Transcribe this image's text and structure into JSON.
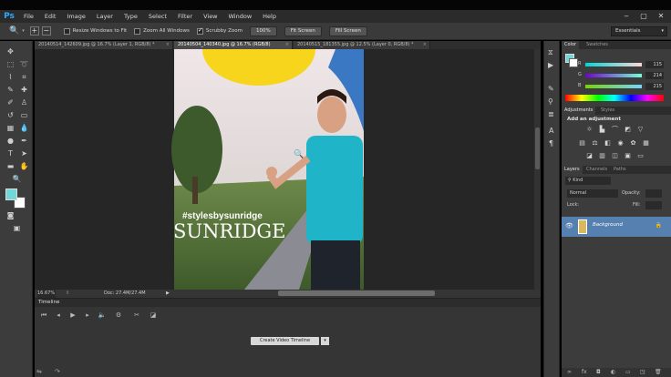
{
  "app": {
    "logo": "Ps"
  },
  "menu": [
    "File",
    "Edit",
    "Image",
    "Layer",
    "Type",
    "Select",
    "Filter",
    "View",
    "Window",
    "Help"
  ],
  "window_controls": {
    "minimize": "‒",
    "maximize": "▢",
    "close": "✕"
  },
  "options": {
    "resize_windows_label": "Resize Windows to Fit",
    "zoom_all_label": "Zoom All Windows",
    "scrubby_label": "Scrubby Zoom",
    "btn_100": "100%",
    "btn_fit": "Fit Screen",
    "btn_fill": "Fill Screen",
    "workspace": "Essentials"
  },
  "tabs": [
    {
      "label": "20140514_142609.jpg @ 16.7% (Layer 1, RGB/8) *"
    },
    {
      "label": "20140504_140340.jpg @ 16.7% (RGB/8)"
    },
    {
      "label": "20140515_181355.jpg @ 12.5% (Layer 0, RGB/8) *"
    }
  ],
  "photo": {
    "hashtag": "#stylesbysunridge",
    "brand": "SUNRIDGE"
  },
  "status": {
    "zoom": "16.67%",
    "doc": "Doc: 27.4M/27.4M"
  },
  "timeline": {
    "title": "Timeline",
    "create_button": "Create Video Timeline"
  },
  "color_panel": {
    "tabs": [
      "Color",
      "Swatches"
    ],
    "rows": [
      {
        "label": "R",
        "value": "115"
      },
      {
        "label": "G",
        "value": "214"
      },
      {
        "label": "B",
        "value": "215"
      }
    ],
    "fg_color": "#73d6d7"
  },
  "adjust_panel": {
    "tabs": [
      "Adjustments",
      "Styles"
    ],
    "heading": "Add an adjustment"
  },
  "layers_panel": {
    "tabs": [
      "Layers",
      "Channels",
      "Paths"
    ],
    "kind": "Kind",
    "blend_mode": "Normal",
    "opacity_label": "Opacity:",
    "lock_label": "Lock:",
    "fill_label": "Fill:",
    "layer_name": "Background"
  },
  "colors": {
    "accent": "#31a8ff",
    "selection": "#5680b0",
    "shirt": "#1fb4c8"
  }
}
